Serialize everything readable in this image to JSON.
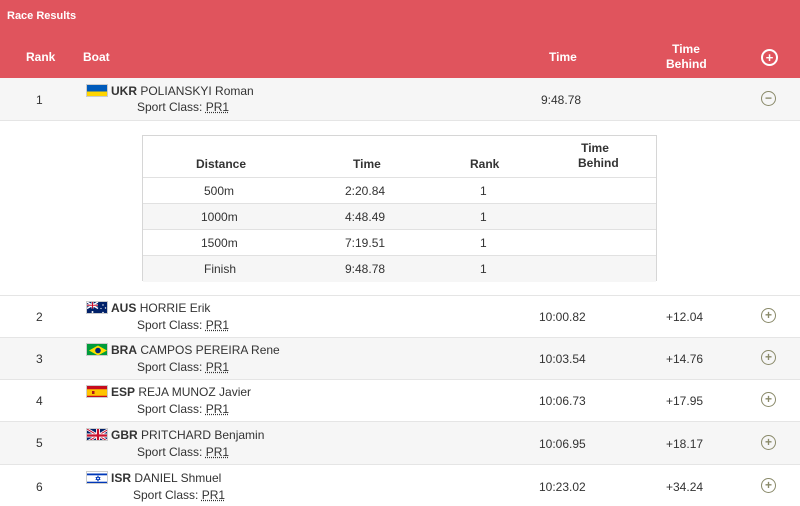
{
  "header": {
    "title": "Race Results",
    "rank_label": "Rank",
    "boat_label": "Boat",
    "time_label": "Time",
    "behind_label_1": "Time",
    "behind_label_2": "Behind",
    "expand_icon": "plus-circle-icon"
  },
  "rows": [
    {
      "rank": "1",
      "code": "UKR",
      "name": "POLIANSKYI Roman",
      "sport_class_label": "Sport Class:",
      "sport_class": "PR1",
      "time": "9:48.78",
      "behind": "",
      "flag": "ukraine",
      "toggle": "−"
    },
    {
      "rank": "2",
      "code": "AUS",
      "name": "HORRIE Erik",
      "sport_class_label": "Sport Class:",
      "sport_class": "PR1",
      "time": "10:00.82",
      "behind": "+12.04",
      "flag": "australia",
      "toggle": "+"
    },
    {
      "rank": "3",
      "code": "BRA",
      "name": "CAMPOS PEREIRA Rene",
      "sport_class_label": "Sport Class:",
      "sport_class": "PR1",
      "time": "10:03.54",
      "behind": "+14.76",
      "flag": "brazil",
      "toggle": "+"
    },
    {
      "rank": "4",
      "code": "ESP",
      "name": "REJA MUNOZ Javier",
      "sport_class_label": "Sport Class:",
      "sport_class": "PR1",
      "time": "10:06.73",
      "behind": "+17.95",
      "flag": "spain",
      "toggle": "+"
    },
    {
      "rank": "5",
      "code": "GBR",
      "name": "PRITCHARD Benjamin",
      "sport_class_label": "Sport Class:",
      "sport_class": "PR1",
      "time": "10:06.95",
      "behind": "+18.17",
      "flag": "great-britain",
      "toggle": "+"
    },
    {
      "rank": "6",
      "code": "ISR",
      "name": "DANIEL Shmuel",
      "sport_class_label": "Sport Class:",
      "sport_class": "PR1",
      "time": "10:23.02",
      "behind": "+34.24",
      "flag": "israel",
      "toggle": "+"
    }
  ],
  "splits": {
    "headers": {
      "distance": "Distance",
      "time": "Time",
      "rank": "Rank",
      "behind_1": "Time",
      "behind_2": "Behind"
    },
    "rows": [
      {
        "distance": "500m",
        "time": "2:20.84",
        "rank": "1"
      },
      {
        "distance": "1000m",
        "time": "4:48.49",
        "rank": "1"
      },
      {
        "distance": "1500m",
        "time": "7:19.51",
        "rank": "1"
      },
      {
        "distance": "Finish",
        "time": "9:48.78",
        "rank": "1"
      }
    ]
  },
  "colors": {
    "header_bg": "#e0545d",
    "toggle": "#8a8a6a"
  }
}
